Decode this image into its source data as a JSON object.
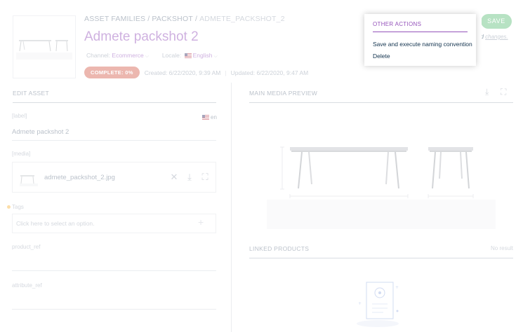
{
  "header": {
    "breadcrumb": {
      "family": "ASSET FAMILIES",
      "separator": "/",
      "code": "PACKSHOT",
      "current": "ADMETE_PACKSHOT_2"
    },
    "title": "Admete packshot 2",
    "channel_label": "Channel:",
    "channel_value": "Ecommerce",
    "locale_label": "Locale:",
    "locale_value": "English",
    "completeness_badge": "COMPLETE: 0%",
    "created": "Created: 6/22/2020, 9:39 AM",
    "pipe": "|",
    "updated": "Updated: 6/22/2020, 9:47 AM",
    "save_label": "SAVE",
    "unsaved_visible": "ved",
    "unsaved_suffix": "changes."
  },
  "other_actions": {
    "title": "OTHER ACTIONS",
    "items": [
      {
        "label": "Save and execute naming convention"
      },
      {
        "label": "Delete"
      }
    ]
  },
  "edit_asset": {
    "section_title": "EDIT ASSET",
    "label_field": {
      "label": "[label]",
      "locale": "en",
      "value": "Admete packshot 2"
    },
    "media_field": {
      "label": "[media]",
      "filename": "admete_packshot_2.jpg"
    },
    "tags_field": {
      "label": "Tags",
      "placeholder": "Click here to select an option."
    },
    "product_ref_field": {
      "label": "product_ref"
    },
    "attribute_ref_field": {
      "label": "attribute_ref"
    }
  },
  "main_media": {
    "section_title": "MAIN MEDIA PREVIEW"
  },
  "linked_products": {
    "section_title": "LINKED PRODUCTS",
    "status": "No result"
  },
  "colors": {
    "brand_purple": "#9452ba",
    "save_green": "#5fbf7a",
    "badge_red": "#d4604f",
    "required_dot": "#f9b53f"
  }
}
